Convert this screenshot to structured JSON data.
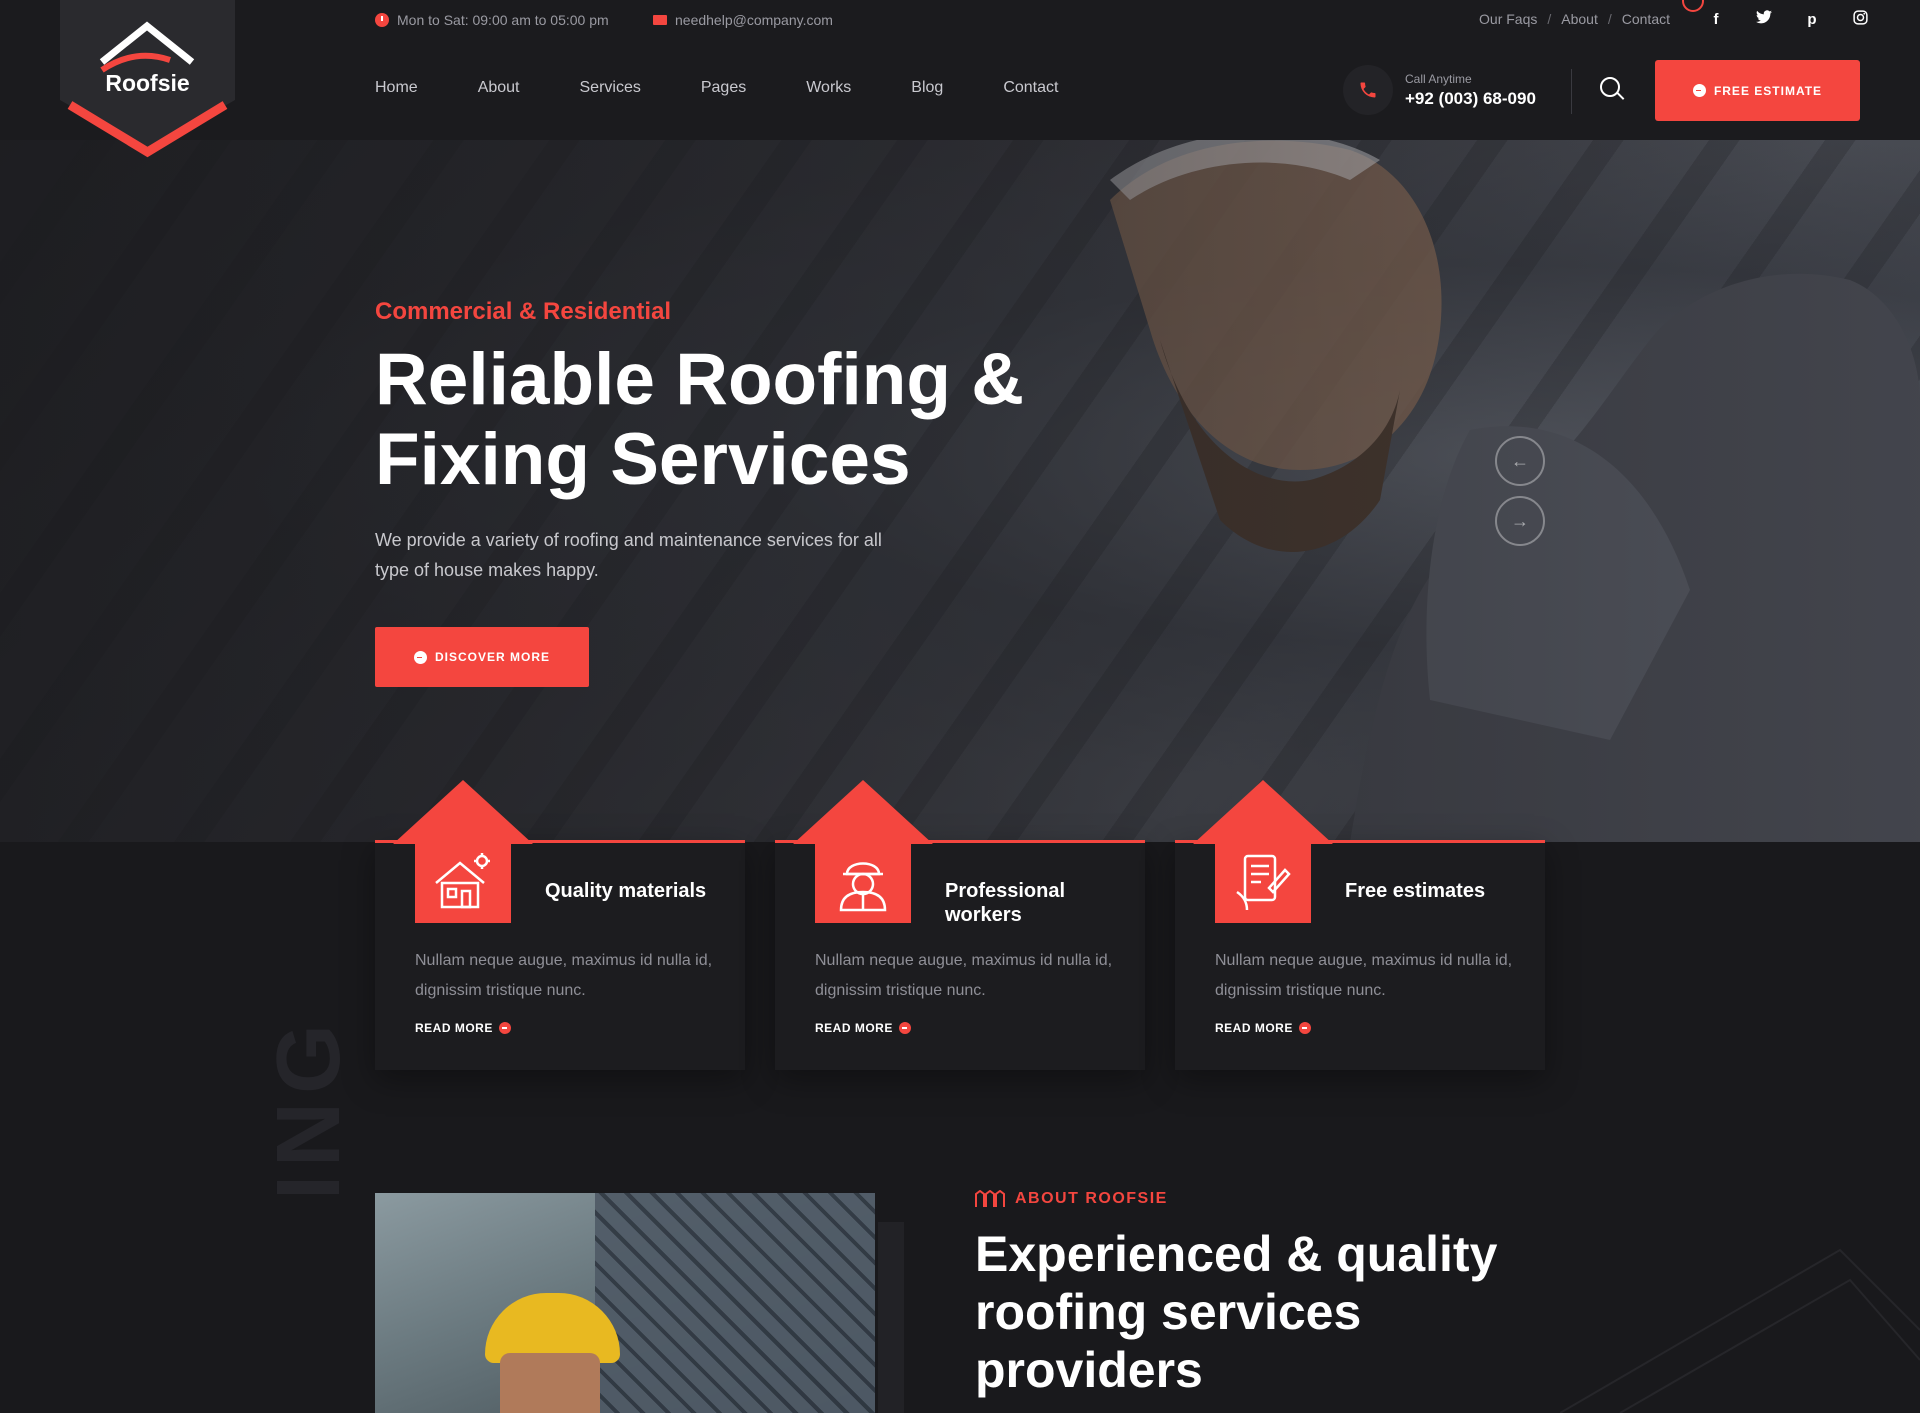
{
  "topbar": {
    "hours": "Mon to Sat: 09:00 am to 05:00 pm",
    "email": "needhelp@company.com",
    "links": [
      "Our Faqs",
      "About",
      "Contact"
    ],
    "separator": "/",
    "socials": [
      "facebook-icon",
      "twitter-icon",
      "pinterest-icon",
      "instagram-icon"
    ],
    "social_glyphs": [
      "f",
      "𝕥",
      "p",
      "◎"
    ]
  },
  "logo": {
    "text": "Roofsie"
  },
  "nav": {
    "items": [
      "Home",
      "About",
      "Services",
      "Pages",
      "Works",
      "Blog",
      "Contact"
    ],
    "call_label": "Call Anytime",
    "call_number": "+92 (003) 68-090",
    "estimate_label": "FREE ESTIMATE"
  },
  "hero": {
    "tag": "Commercial & Residential",
    "title": "Reliable Roofing & Fixing Services",
    "description": "We provide a variety of roofing and maintenance services for all type of house makes happy.",
    "button": "DISCOVER MORE",
    "prev_arrow": "←",
    "next_arrow": "→"
  },
  "features": [
    {
      "icon": "house-icon",
      "title": "Quality materials",
      "text": "Nullam neque augue, maximus id nulla id, dignissim tristique nunc.",
      "link": "READ MORE"
    },
    {
      "icon": "worker-icon",
      "title": "Professional workers",
      "text": "Nullam neque augue, maximus id nulla id, dignissim tristique nunc.",
      "link": "READ MORE"
    },
    {
      "icon": "estimate-icon",
      "title": "Free estimates",
      "text": "Nullam neque augue, maximus id nulla id, dignissim tristique nunc.",
      "link": "READ MORE"
    }
  ],
  "about": {
    "vertical_text": "ING",
    "tag": "ABOUT ROOFSIE",
    "title": "Experienced & quality roofing services providers"
  },
  "colors": {
    "accent": "#f4463f",
    "background": "#19191c",
    "bar": "#1b1b1e"
  }
}
